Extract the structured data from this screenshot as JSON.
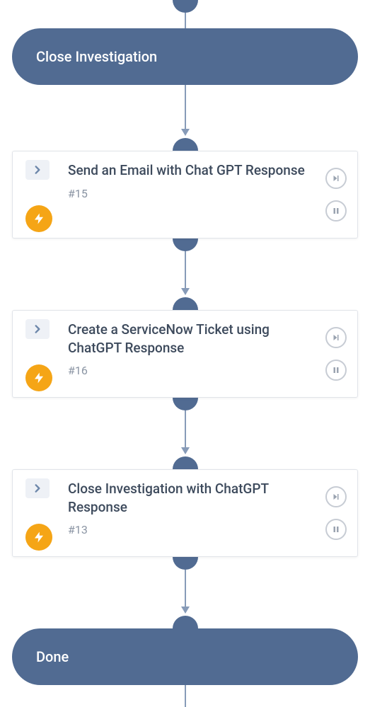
{
  "colors": {
    "node_fill": "#516b92",
    "connector": "#879bb8",
    "bolt_badge": "#f5a516",
    "card_border": "#e1e4e9",
    "title_text": "#3d4a5c",
    "muted_text": "#8a94a3",
    "action_border": "#c7ccd4"
  },
  "start_node": {
    "label": "Close Investigation"
  },
  "steps": [
    {
      "title": "Send an Email with Chat GPT Response",
      "id": "#15"
    },
    {
      "title": "Create a ServiceNow Ticket using ChatGPT Response",
      "id": "#16"
    },
    {
      "title": "Close Investigation with ChatGPT Response",
      "id": "#13"
    }
  ],
  "end_node": {
    "label": "Done"
  },
  "icons": {
    "chevron": "chevron-right-icon",
    "bolt": "lightning-icon",
    "skip": "skip-icon",
    "pause": "pause-icon"
  }
}
